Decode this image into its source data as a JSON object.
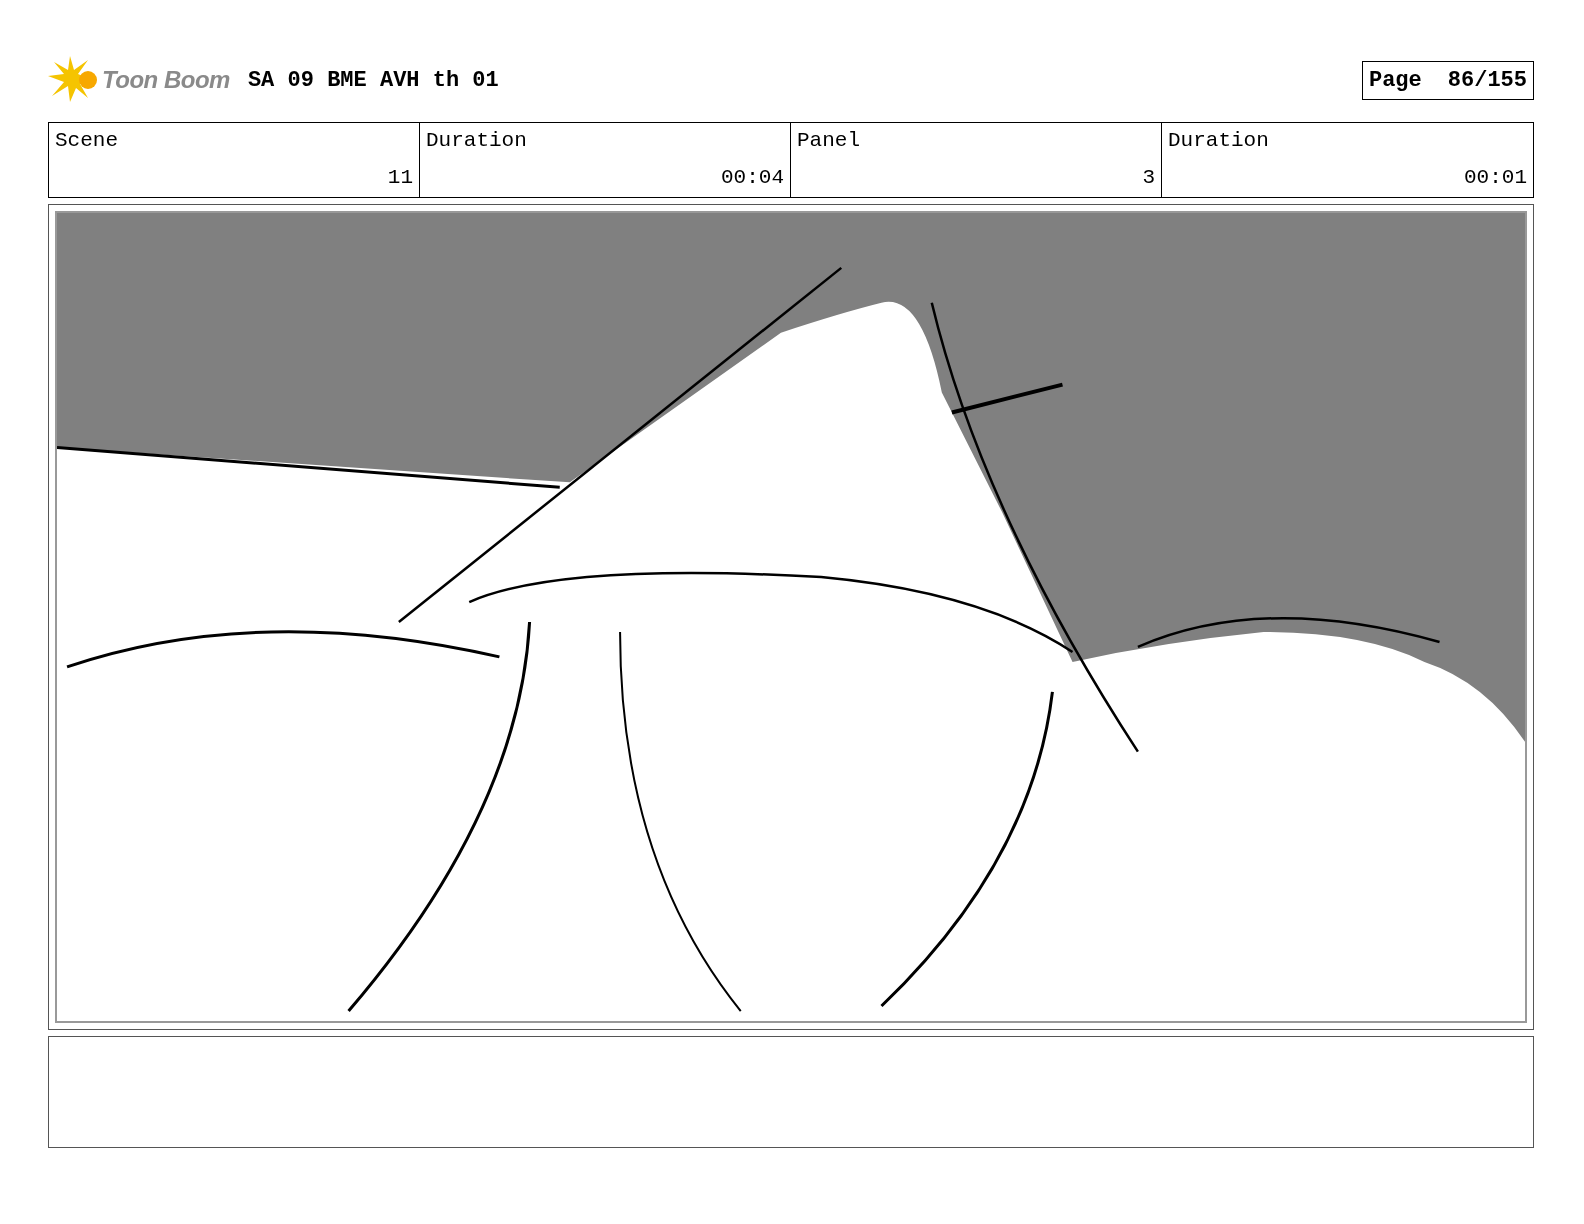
{
  "logo": {
    "text": "Toon Boom"
  },
  "title": "SA 09 BME AVH th 01",
  "page": {
    "label": "Page",
    "value": "86/155"
  },
  "info_table": {
    "labels": [
      "Scene",
      "Duration",
      "Panel",
      "Duration"
    ],
    "values": [
      "11",
      "00:04",
      "3",
      "00:01"
    ]
  }
}
